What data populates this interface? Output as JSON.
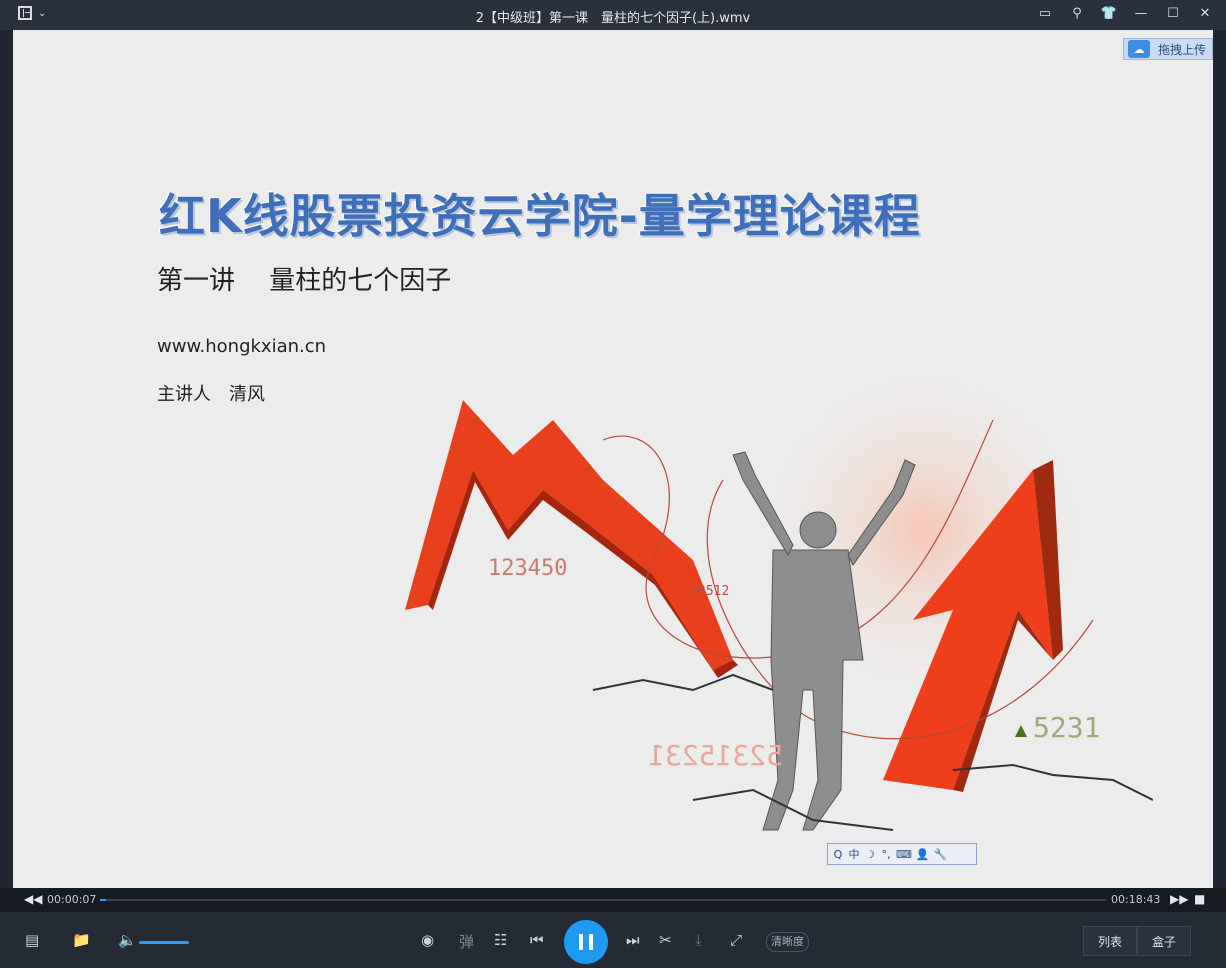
{
  "window": {
    "title": "2【中级班】第一课　量柱的七个因子(上).wmv",
    "icons": [
      "playlist-icon",
      "chevron-down-icon",
      "feedback-icon",
      "pin-icon",
      "skin-icon",
      "minimize-icon",
      "maximize-icon",
      "close-icon"
    ]
  },
  "upload": {
    "label": "拖拽上传"
  },
  "slide": {
    "title": "红K线股票投资云学院-量学理论课程",
    "subtitle": "第一讲　 量柱的七个因子",
    "url": "www.hongkxian.cn",
    "speaker": "主讲人　清风",
    "numbers": {
      "n1": "123450",
      "n2": "3512",
      "n3": "5231",
      "n4": "52315231"
    }
  },
  "ime": {
    "items": [
      "Q",
      "中",
      "☽",
      "°,",
      "⌨",
      "👤",
      "🔧"
    ]
  },
  "progress": {
    "elapsed": "00:00:07",
    "total": "00:18:43",
    "fraction": 0.006
  },
  "controls": {
    "volume_level": 1.0,
    "danmaku_label": "弹",
    "quality_label": "清晰度",
    "list_label": "列表",
    "box_label": "盒子"
  },
  "colors": {
    "accent": "#1f9af3",
    "title_blue": "#3f6fb8",
    "arrow_red": "#e8401c"
  }
}
